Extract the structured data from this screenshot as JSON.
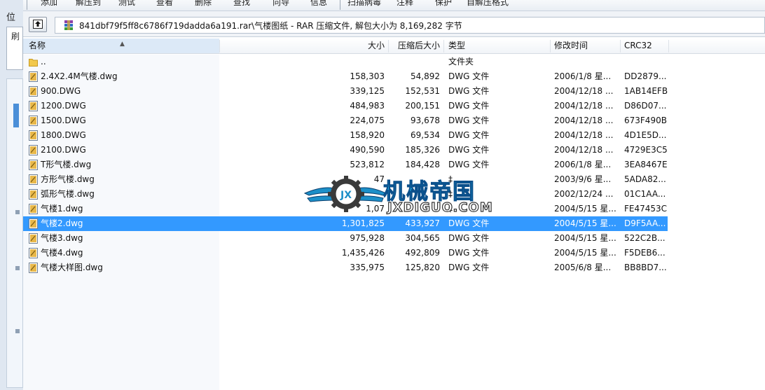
{
  "left_panel": {
    "position_char": "位",
    "box_char": "刷"
  },
  "toolbar": {
    "buttons": [
      "添加",
      "解压到",
      "测试",
      "查看",
      "删除",
      "查找",
      "向导",
      "信息",
      "扫描病毒",
      "注释",
      "保护",
      "自解压格式"
    ]
  },
  "address": {
    "up_icon": "up-arrow-icon",
    "archive_icon": "rar-archive-icon",
    "path": "841dbf79f5ff8c6786f719dadda6a191.rar\\气楼图纸 - RAR 压缩文件, 解包大小为 8,169,282 字节"
  },
  "columns": {
    "name": "名称",
    "size": "大小",
    "packed": "压缩后大小",
    "type": "类型",
    "modified": "修改时间",
    "crc": "CRC32"
  },
  "files": [
    {
      "name": "..",
      "size": "",
      "packed": "",
      "type": "文件夹",
      "modified": "",
      "crc": "",
      "icon": "folder-icon"
    },
    {
      "name": "2.4X2.4M气楼.dwg",
      "size": "158,303",
      "packed": "54,892",
      "type": "DWG 文件",
      "modified": "2006/1/8 星...",
      "crc": "DD2879...",
      "icon": "dwg-file-icon"
    },
    {
      "name": "900.DWG",
      "size": "339,125",
      "packed": "152,531",
      "type": "DWG 文件",
      "modified": "2004/12/18 ...",
      "crc": "1AB14EFB",
      "icon": "dwg-file-icon"
    },
    {
      "name": "1200.DWG",
      "size": "484,983",
      "packed": "200,151",
      "type": "DWG 文件",
      "modified": "2004/12/18 ...",
      "crc": "D86D07...",
      "icon": "dwg-file-icon"
    },
    {
      "name": "1500.DWG",
      "size": "224,075",
      "packed": "93,678",
      "type": "DWG 文件",
      "modified": "2004/12/18 ...",
      "crc": "673F490B",
      "icon": "dwg-file-icon"
    },
    {
      "name": "1800.DWG",
      "size": "158,920",
      "packed": "69,534",
      "type": "DWG 文件",
      "modified": "2004/12/18 ...",
      "crc": "4D1E5D...",
      "icon": "dwg-file-icon"
    },
    {
      "name": "2100.DWG",
      "size": "490,590",
      "packed": "185,326",
      "type": "DWG 文件",
      "modified": "2004/12/18 ...",
      "crc": "4729E3C5",
      "icon": "dwg-file-icon"
    },
    {
      "name": "T形气楼.dwg",
      "size": "523,812",
      "packed": "184,428",
      "type": "DWG 文件",
      "modified": "2006/1/8 星...",
      "crc": "3EA8467E",
      "icon": "dwg-file-icon"
    },
    {
      "name": "方形气楼.dwg",
      "size": "47",
      "packed": "",
      "type": "‡",
      "modified": "2003/9/6 星...",
      "crc": "5ADA82...",
      "icon": "dwg-file-icon"
    },
    {
      "name": "弧形气楼.dwg",
      "size": "",
      "packed": "",
      "type": "‡",
      "modified": "2002/12/24 ...",
      "crc": "01C1AA...",
      "icon": "dwg-file-icon"
    },
    {
      "name": "气楼1.dwg",
      "size": "1,07",
      "packed": "",
      "type": "‡",
      "modified": "2004/5/15 星...",
      "crc": "FE47453C",
      "icon": "dwg-file-icon"
    },
    {
      "name": "气楼2.dwg",
      "size": "1,301,825",
      "packed": "433,927",
      "type": "DWG 文件",
      "modified": "2004/5/15 星...",
      "crc": "D9F5AA...",
      "icon": "dwg-file-icon",
      "selected": true
    },
    {
      "name": "气楼3.dwg",
      "size": "975,928",
      "packed": "304,565",
      "type": "DWG 文件",
      "modified": "2004/5/15 星...",
      "crc": "522C2B...",
      "icon": "dwg-file-icon"
    },
    {
      "name": "气楼4.dwg",
      "size": "1,435,426",
      "packed": "492,809",
      "type": "DWG 文件",
      "modified": "2004/5/15 星...",
      "crc": "F5DEB6...",
      "icon": "dwg-file-icon"
    },
    {
      "name": "气楼大样图.dwg",
      "size": "335,975",
      "packed": "125,820",
      "type": "DWG 文件",
      "modified": "2005/6/8 星...",
      "crc": "BB8BD7...",
      "icon": "dwg-file-icon"
    }
  ],
  "watermark": {
    "cn": "机械帝国",
    "en": "JXDIGUO.COM",
    "icon": "winged-gear-logo-icon"
  },
  "colors": {
    "selection": "#3399ff",
    "accent": "#18a0d8"
  }
}
